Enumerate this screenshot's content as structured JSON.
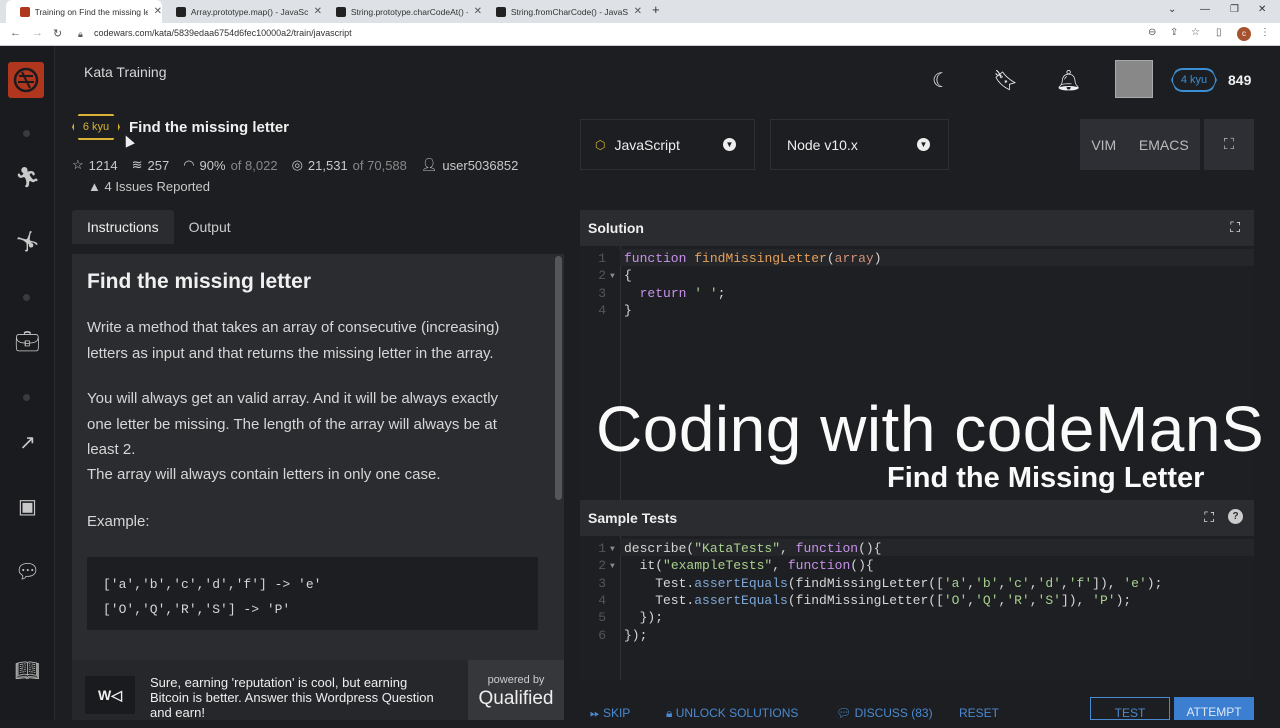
{
  "browser": {
    "tabs": [
      {
        "title": "Training on Find the missing lette",
        "active": true
      },
      {
        "title": "Array.prototype.map() - JavaScrip",
        "active": false
      },
      {
        "title": "String.prototype.charCodeAt() - J",
        "active": false
      },
      {
        "title": "String.fromCharCode() - JavaScrip",
        "active": false
      }
    ],
    "url": "codewars.com/kata/5839edaa6754d6fec10000a2/train/javascript",
    "profile_initial": "c"
  },
  "header": {
    "section_title": "Kata Training",
    "rank": "4 kyu",
    "honor": "849"
  },
  "kata": {
    "kyu": "6 kyu",
    "title": "Find the missing letter",
    "stars": "1214",
    "collections": "257",
    "satisfaction": "90%",
    "satisfaction_of": "of 8,022",
    "completed": "21,531",
    "completed_of": "of 70,588",
    "author": "user5036852",
    "issues": "4 Issues Reported"
  },
  "tabs": {
    "instructions": "Instructions",
    "output": "Output"
  },
  "instructions": {
    "heading": "Find the missing letter",
    "p1": "Write a method that takes an array of consecutive (increasing) letters as input and that returns the missing letter in the array.",
    "p2": "You will always get an valid array. And it will be always exactly one letter be missing. The length of the array will always be at least 2.",
    "p3": "The array will always contain letters in only one case.",
    "example_label": "Example:",
    "example_line1": "['a','b','c','d','f'] -> 'e'",
    "example_line2": "['O','Q','R','S'] -> 'P'"
  },
  "ad": {
    "text": "Sure, earning 'reputation' is cool, but earning Bitcoin is better. Answer this Wordpress Question and earn!",
    "powered_by": "powered by",
    "brand": "Qualified"
  },
  "toolbar": {
    "language": "JavaScript",
    "version": "Node v10.x",
    "vim": "VIM",
    "emacs": "EMACS"
  },
  "solution": {
    "title": "Solution",
    "line_numbers": [
      "1",
      "2",
      "3",
      "4"
    ]
  },
  "watermark": {
    "line1": "Coding with codeManS",
    "line2": "Find the Missing Letter"
  },
  "sample_tests": {
    "title": "Sample Tests",
    "line_numbers": [
      "1",
      "2",
      "3",
      "4",
      "5",
      "6"
    ]
  },
  "actions": {
    "skip": "SKIP",
    "unlock": "UNLOCK SOLUTIONS",
    "discuss": "DISCUSS (83)",
    "reset": "RESET",
    "test": "TEST",
    "attempt": "ATTEMPT"
  },
  "colors": {
    "accent_blue": "#3c7fd0",
    "kyu_yellow": "#d8b234",
    "brand_red": "#b1361e"
  }
}
